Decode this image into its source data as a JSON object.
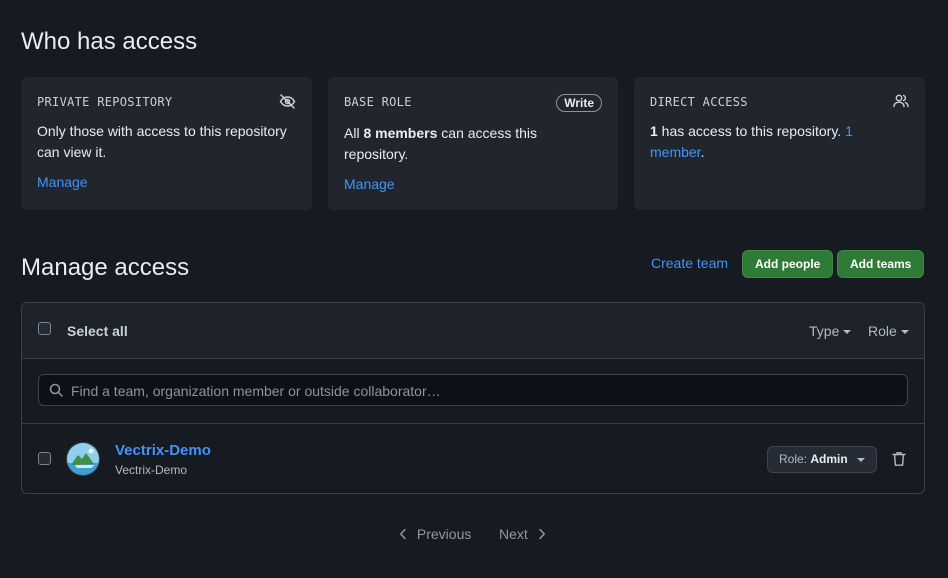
{
  "who_has_access": {
    "title": "Who has access",
    "cards": [
      {
        "kicker": "PRIVATE REPOSITORY",
        "text": "Only those with access to this repository can view it.",
        "link": "Manage",
        "icon": "eye-closed-icon"
      },
      {
        "kicker": "BASE ROLE",
        "badge": "Write",
        "text_pre": "All ",
        "text_bold": "8 members",
        "text_post": " can access this repository.",
        "link": "Manage"
      },
      {
        "kicker": "DIRECT ACCESS",
        "icon": "people-icon",
        "text_bold": "1",
        "text_mid": " has access to this repository. ",
        "text_link": "1 member",
        "text_end": "."
      }
    ]
  },
  "manage_access": {
    "title": "Manage access",
    "create_team": "Create team",
    "add_people": "Add people",
    "add_teams": "Add teams",
    "select_all": "Select all",
    "filters": {
      "type": "Type",
      "role": "Role"
    },
    "search_placeholder": "Find a team, organization member or outside collaborator…",
    "members": [
      {
        "name": "Vectrix-Demo",
        "sub": "Vectrix-Demo",
        "role_label": "Role:",
        "role_value": "Admin"
      }
    ]
  },
  "pagination": {
    "previous": "Previous",
    "next": "Next"
  },
  "colors": {
    "accent_link": "#4493f8",
    "primary_button": "#2f7a37",
    "background": "#161a21"
  }
}
